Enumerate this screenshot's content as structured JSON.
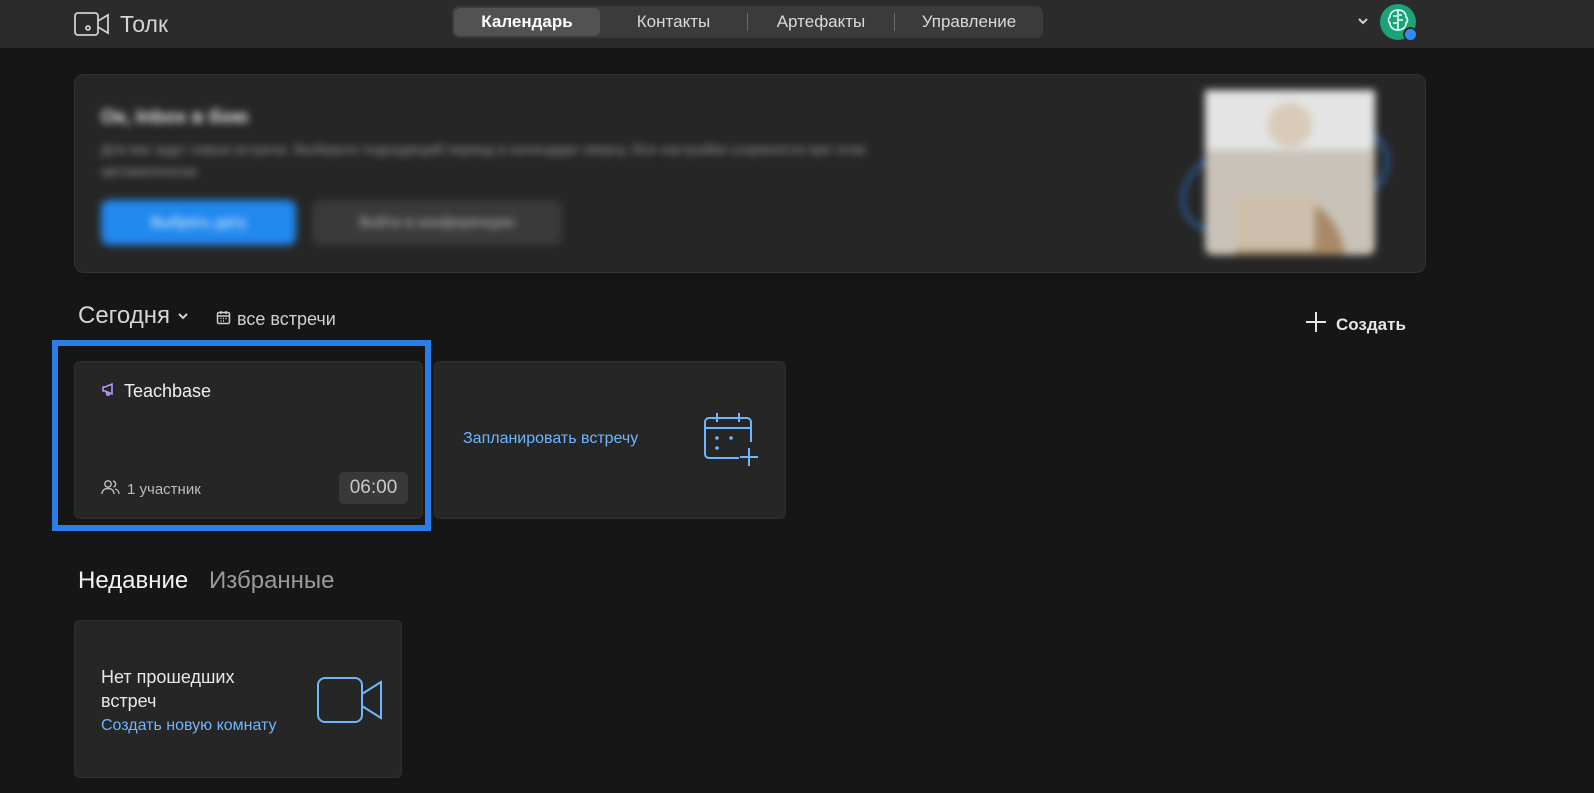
{
  "app": {
    "name": "Толк",
    "logo_icon": "video-camera-logo-icon"
  },
  "nav": {
    "tabs": [
      {
        "label": "Календарь",
        "active": true
      },
      {
        "label": "Контакты",
        "active": false
      },
      {
        "label": "Артефакты",
        "active": false
      },
      {
        "label": "Управление",
        "active": false
      }
    ]
  },
  "user": {
    "avatar_icon": "brain-avatar-icon",
    "status_color": "#2b8ef5",
    "avatar_color": "#1aa37a"
  },
  "banner": {
    "title": "Ок, Inbox в бою",
    "description": "Для вас ждут новые встречи. Выберите подходящий период в календаре сверху. Все настройки сохранятся при этом автоматически",
    "primary_button": "Выбрать дату",
    "secondary_button": "Войти в конференцию"
  },
  "today": {
    "title": "Сегодня",
    "all_meetings": "все встречи",
    "create": "Создать"
  },
  "meetings": [
    {
      "title": "Teachbase",
      "participants": "1 участник",
      "time": "06:00",
      "icon": "megaphone-icon"
    }
  ],
  "schedule": {
    "label": "Запланировать встречу",
    "icon": "calendar-plus-icon"
  },
  "tabs": {
    "recent": "Недавние",
    "favorites": "Избранные"
  },
  "empty_state": {
    "title": "Нет прошедших встреч",
    "link": "Создать новую комнату",
    "icon": "video-camera-icon"
  },
  "colors": {
    "accent": "#2188ee",
    "link": "#6eb6ff",
    "highlight": "#2a7ee6",
    "background": "#161616"
  }
}
